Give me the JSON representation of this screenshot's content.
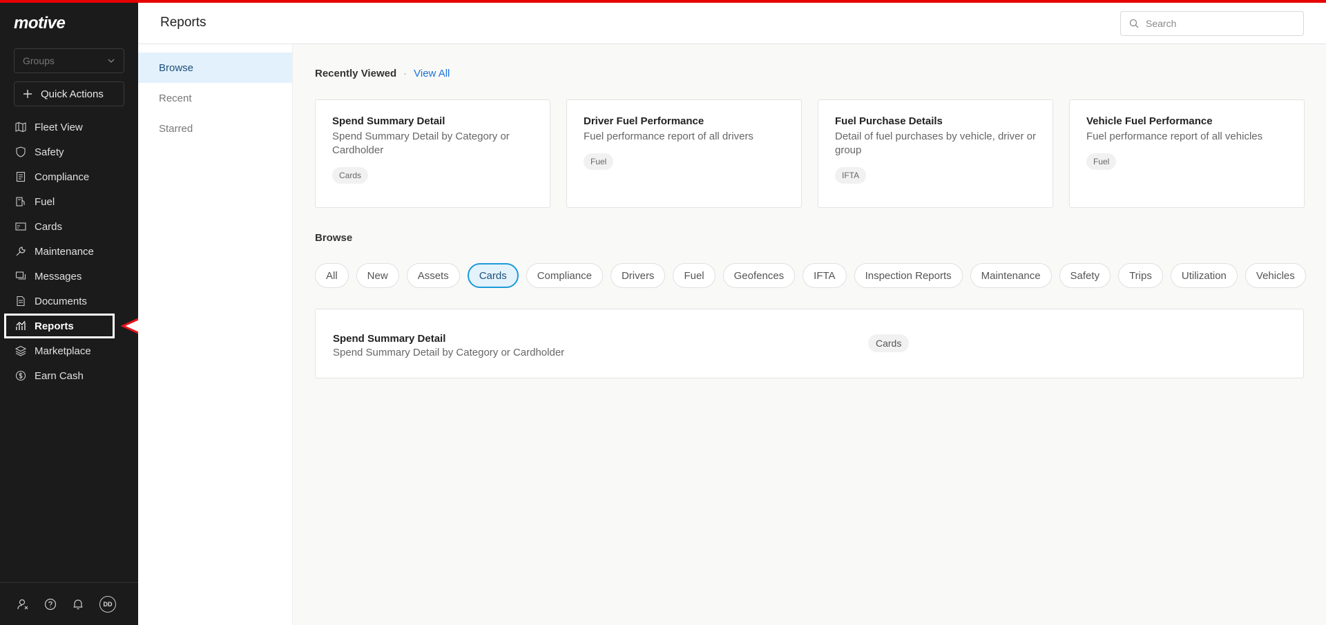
{
  "app": {
    "logo": "motive"
  },
  "sidebar": {
    "groups_placeholder": "Groups",
    "quick_actions": "Quick Actions",
    "items": [
      {
        "label": "Fleet View",
        "icon": "map-icon"
      },
      {
        "label": "Safety",
        "icon": "shield-icon"
      },
      {
        "label": "Compliance",
        "icon": "clipboard-icon"
      },
      {
        "label": "Fuel",
        "icon": "fuel-icon"
      },
      {
        "label": "Cards",
        "icon": "card-icon"
      },
      {
        "label": "Maintenance",
        "icon": "wrench-icon"
      },
      {
        "label": "Messages",
        "icon": "messages-icon"
      },
      {
        "label": "Documents",
        "icon": "document-icon"
      },
      {
        "label": "Reports",
        "icon": "chart-icon",
        "active": true
      },
      {
        "label": "Marketplace",
        "icon": "layers-icon"
      },
      {
        "label": "Earn Cash",
        "icon": "dollar-icon"
      }
    ],
    "avatar_initials": "DD"
  },
  "header": {
    "title": "Reports",
    "search_placeholder": "Search"
  },
  "subnav": {
    "items": [
      "Browse",
      "Recent",
      "Starred"
    ],
    "active": "Browse"
  },
  "recent": {
    "label": "Recently Viewed",
    "separator": "·",
    "view_all": "View All",
    "cards": [
      {
        "title": "Spend Summary Detail",
        "desc": "Spend Summary Detail by Category or Cardholder",
        "tag": "Cards"
      },
      {
        "title": "Driver Fuel Performance",
        "desc": "Fuel performance report of all drivers",
        "tag": "Fuel"
      },
      {
        "title": "Fuel Purchase Details",
        "desc": "Detail of fuel purchases by vehicle, driver or group",
        "tag": "IFTA"
      },
      {
        "title": "Vehicle Fuel Performance",
        "desc": "Fuel performance report of all vehicles",
        "tag": "Fuel"
      }
    ]
  },
  "browse": {
    "label": "Browse",
    "chips": [
      "All",
      "New",
      "Assets",
      "Cards",
      "Compliance",
      "Drivers",
      "Fuel",
      "Geofences",
      "IFTA",
      "Inspection Reports",
      "Maintenance",
      "Safety",
      "Trips",
      "Utilization",
      "Vehicles"
    ],
    "active_chip": "Cards",
    "results": [
      {
        "title": "Spend Summary Detail",
        "desc": "Spend Summary Detail by Category or Cardholder",
        "tag": "Cards"
      }
    ]
  },
  "colors": {
    "accent_bar": "#e60000",
    "link": "#1a73d9",
    "sidebar_bg": "#1b1b1b",
    "active_chip": "#1a9ad9"
  }
}
